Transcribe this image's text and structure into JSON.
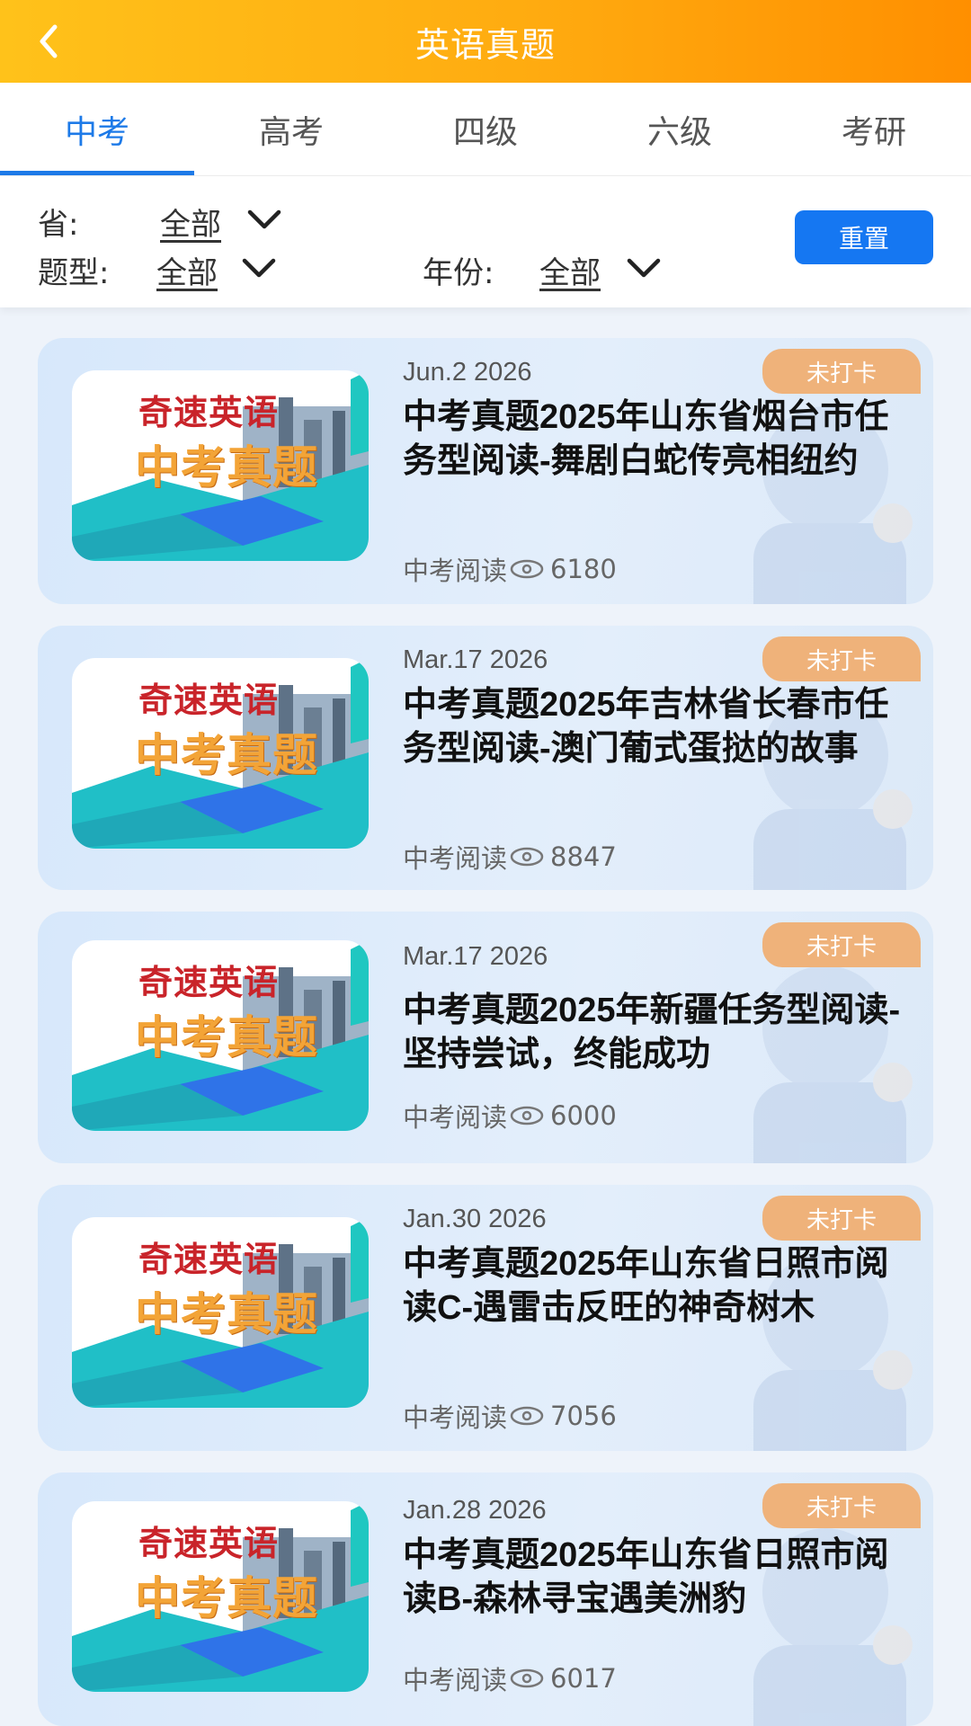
{
  "header": {
    "title": "英语真题"
  },
  "tabs": [
    {
      "label": "中考",
      "active": true
    },
    {
      "label": "高考",
      "active": false
    },
    {
      "label": "四级",
      "active": false
    },
    {
      "label": "六级",
      "active": false
    },
    {
      "label": "考研",
      "active": false
    }
  ],
  "filters": {
    "province_label": "省:",
    "province_value": "全部",
    "type_label": "题型:",
    "type_value": "全部",
    "year_label": "年份:",
    "year_value": "全部",
    "reset_label": "重置"
  },
  "thumbnail": {
    "line1": "奇速英语",
    "line2": "中考真题"
  },
  "articles": [
    {
      "date": "Jun.2 2026",
      "title": "中考真题2025年山东省烟台市任务型阅读-舞剧白蛇传亮相纽约",
      "category": "中考阅读",
      "views": "6180",
      "status": "未打卡"
    },
    {
      "date": "Mar.17 2026",
      "title": "中考真题2025年吉林省长春市任务型阅读-澳门葡式蛋挞的故事",
      "category": "中考阅读",
      "views": "8847",
      "status": "未打卡"
    },
    {
      "date": "Mar.17 2026",
      "title": "中考真题2025年新疆任务型阅读-坚持尝试，终能成功",
      "category": "中考阅读",
      "views": "6000",
      "status": "未打卡"
    },
    {
      "date": "Jan.30 2026",
      "title": "中考真题2025年山东省日照市阅读C-遇雷击反旺的神奇树木",
      "category": "中考阅读",
      "views": "7056",
      "status": "未打卡"
    },
    {
      "date": "Jan.28 2026",
      "title": "中考真题2025年山东省日照市阅读B-森林寻宝遇美洲豹",
      "category": "中考阅读",
      "views": "6017",
      "status": "未打卡"
    }
  ]
}
